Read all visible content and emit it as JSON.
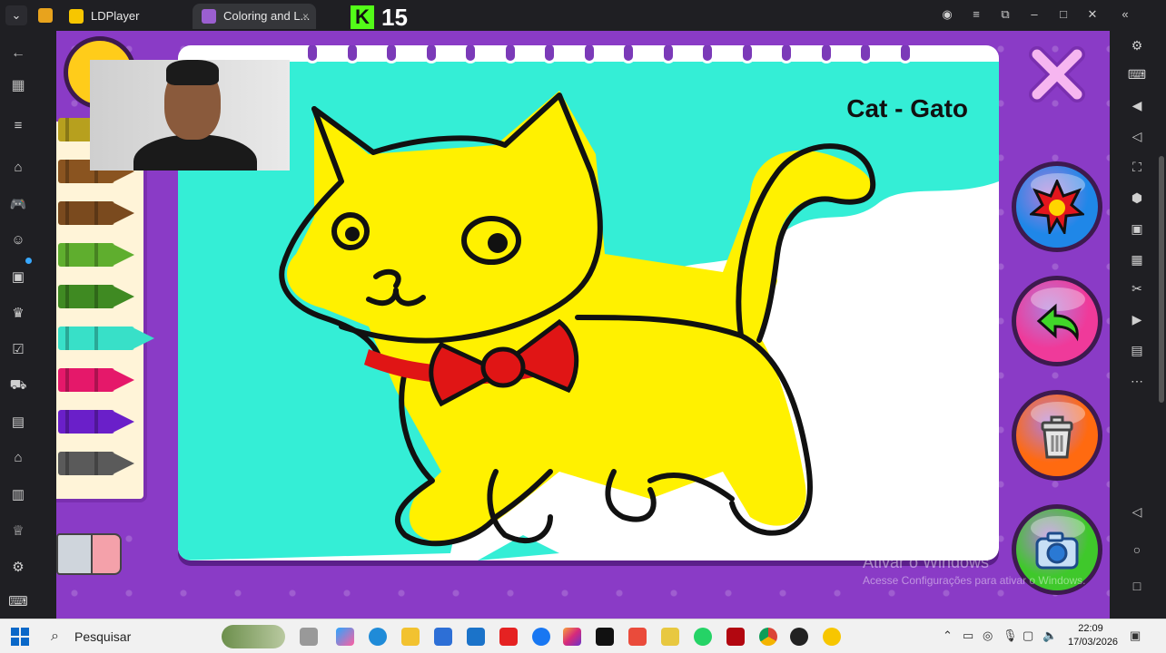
{
  "browser": {
    "tabs": [
      {
        "label": "LDPlayer",
        "active": false
      },
      {
        "label": "Coloring and L...",
        "active": true
      }
    ],
    "tab_close": "×"
  },
  "stream_overlay": {
    "kick_logo": "K",
    "viewer_count": "15"
  },
  "game": {
    "page_title": "Cat - Gato",
    "crayons": [
      {
        "color": "#b7a01e"
      },
      {
        "color": "#8a5420"
      },
      {
        "color": "#7a4a1e"
      },
      {
        "color": "#5fae2e"
      },
      {
        "color": "#3f8a22"
      },
      {
        "color": "#38e0c8",
        "selected": true
      },
      {
        "color": "#e5186a"
      },
      {
        "color": "#6a1fc9"
      },
      {
        "color": "#5a5a5a"
      }
    ],
    "right_buttons": [
      {
        "name": "stickers-button",
        "color": "#1f87e8",
        "icon": "star-burst-icon"
      },
      {
        "name": "undo-button",
        "color": "#ef3a9a",
        "icon": "undo-arrow-icon"
      },
      {
        "name": "trash-button",
        "color": "#ff6a10",
        "icon": "trash-icon"
      },
      {
        "name": "camera-button",
        "color": "#3fc82b",
        "icon": "camera-icon"
      }
    ],
    "colors": {
      "background": "#8a3bc6",
      "fill_cyan": "#34eed6",
      "fill_yellow": "#fff100",
      "bow_red": "#e01515"
    }
  },
  "watermark": {
    "line1": "Ativar o Windows",
    "line2": "Acesse Configurações para ativar o Windows."
  },
  "taskbar": {
    "search_label": "Pesquisar",
    "time": "22:09",
    "date": "17/03/2026"
  }
}
